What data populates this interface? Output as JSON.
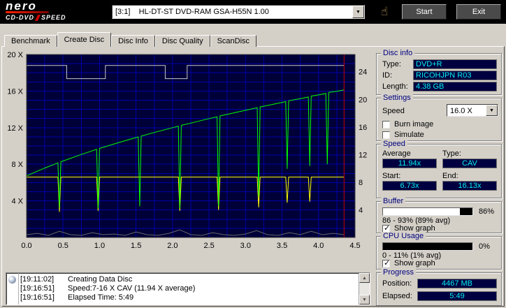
{
  "icons": {
    "dropdown_arrow": "▼",
    "scroll_up_arrow": "▲",
    "scroll_down_arrow": "▼",
    "hand_pointer": "☝"
  },
  "header": {
    "logo": {
      "name": "nero",
      "sub_left": "CD-DVD",
      "sub_right": "SPEED"
    },
    "drive_combo": {
      "value": "[3:1]    HL-DT-ST DVD-RAM GSA-H55N 1.00"
    },
    "start_button": "Start",
    "exit_button": "Exit"
  },
  "tabs": {
    "items": [
      {
        "label": "Benchmark",
        "active": false
      },
      {
        "label": "Create Disc",
        "active": true
      },
      {
        "label": "Disc Info",
        "active": false
      },
      {
        "label": "Disc Quality",
        "active": false
      },
      {
        "label": "ScanDisc",
        "active": false
      }
    ]
  },
  "chart_data": {
    "type": "line",
    "title": "",
    "xlabel": "",
    "x_axis": {
      "lim": [
        0,
        4.5
      ],
      "ticks": [
        {
          "v": 0,
          "label": "0.0"
        },
        {
          "v": 0.5,
          "label": "0.5"
        },
        {
          "v": 1.0,
          "label": "1.0"
        },
        {
          "v": 1.5,
          "label": "1.5"
        },
        {
          "v": 2.0,
          "label": "2.0"
        },
        {
          "v": 2.5,
          "label": "2.5"
        },
        {
          "v": 3.0,
          "label": "3.0"
        },
        {
          "v": 3.5,
          "label": "3.5"
        },
        {
          "v": 4.0,
          "label": "4.0"
        },
        {
          "v": 4.5,
          "label": "4.5"
        }
      ]
    },
    "left_axis": {
      "lim": [
        0,
        20
      ],
      "ticks": [
        {
          "v": 20,
          "label": "20 X"
        },
        {
          "v": 16,
          "label": "16 X"
        },
        {
          "v": 12,
          "label": "12 X"
        },
        {
          "v": 8,
          "label": "8 X"
        },
        {
          "v": 4,
          "label": "4 X"
        }
      ]
    },
    "right_axis": {
      "lim": [
        0,
        26.5
      ],
      "ticks": [
        {
          "v": 24,
          "label": "24"
        },
        {
          "v": 20,
          "label": "20"
        },
        {
          "v": 16,
          "label": "16"
        },
        {
          "v": 12,
          "label": "12"
        },
        {
          "v": 8,
          "label": "8"
        },
        {
          "v": 4,
          "label": "4"
        }
      ]
    },
    "grid": {
      "bg": "#000038",
      "color": "#0000a8",
      "x_step": 0.25,
      "y_step": 1
    },
    "position_line": {
      "x": 4.35,
      "color": "#c00000"
    },
    "series": [
      {
        "name": "cpu_usage",
        "color": "#686868",
        "axis": "right",
        "points": [
          [
            0,
            0.4
          ],
          [
            0.15,
            0.6
          ],
          [
            0.3,
            0.3
          ],
          [
            0.45,
            0.9
          ],
          [
            0.6,
            0.4
          ],
          [
            0.75,
            0.3
          ],
          [
            0.9,
            0.7
          ],
          [
            1.05,
            0.4
          ],
          [
            1.2,
            0.5
          ],
          [
            1.35,
            0.3
          ],
          [
            1.5,
            0.8
          ],
          [
            1.65,
            0.4
          ],
          [
            1.8,
            0.3
          ],
          [
            1.95,
            0.6
          ],
          [
            2.1,
            1.1
          ],
          [
            2.25,
            0.4
          ],
          [
            2.4,
            0.3
          ],
          [
            2.55,
            0.7
          ],
          [
            2.7,
            0.4
          ],
          [
            2.85,
            0.3
          ],
          [
            3.0,
            0.5
          ],
          [
            3.15,
            1.0
          ],
          [
            3.3,
            0.4
          ],
          [
            3.45,
            0.3
          ],
          [
            3.6,
            0.7
          ],
          [
            3.75,
            0.4
          ],
          [
            3.9,
            0.9
          ],
          [
            4.05,
            0.4
          ],
          [
            4.2,
            0.6
          ],
          [
            4.35,
            0.4
          ]
        ]
      },
      {
        "name": "buffer_level",
        "color": "#c8c8c8",
        "axis": "right",
        "points": [
          [
            0,
            24.9
          ],
          [
            0.55,
            24.9
          ],
          [
            0.55,
            23.0
          ],
          [
            1.08,
            23.0
          ],
          [
            1.08,
            24.9
          ],
          [
            1.9,
            24.9
          ],
          [
            1.9,
            23.0
          ],
          [
            2.2,
            23.0
          ],
          [
            2.2,
            24.9
          ],
          [
            4.35,
            24.9
          ]
        ]
      },
      {
        "name": "secondary_speed",
        "color": "#ffff00",
        "axis": "left",
        "points": [
          [
            0,
            6.6
          ],
          [
            0.43,
            6.6
          ],
          [
            0.45,
            2.8
          ],
          [
            0.47,
            6.6
          ],
          [
            0.96,
            6.6
          ],
          [
            0.98,
            2.9
          ],
          [
            1.0,
            6.6
          ],
          [
            2.08,
            6.6
          ],
          [
            2.1,
            2.9
          ],
          [
            2.12,
            6.6
          ],
          [
            2.61,
            6.6
          ],
          [
            2.63,
            3.0
          ],
          [
            2.65,
            6.6
          ],
          [
            3.16,
            6.6
          ],
          [
            3.18,
            3.3
          ],
          [
            3.2,
            6.6
          ],
          [
            3.55,
            6.6
          ],
          [
            3.57,
            3.8
          ],
          [
            3.59,
            6.6
          ],
          [
            3.86,
            6.6
          ],
          [
            3.88,
            3.9
          ],
          [
            3.9,
            6.6
          ],
          [
            4.35,
            6.6
          ]
        ]
      },
      {
        "name": "write_speed",
        "color": "#00ff00",
        "axis": "left",
        "points": [
          [
            0,
            6.73
          ],
          [
            0.25,
            7.59
          ],
          [
            0.43,
            8.15
          ],
          [
            0.45,
            3.3
          ],
          [
            0.47,
            8.27
          ],
          [
            0.5,
            8.36
          ],
          [
            0.75,
            9.07
          ],
          [
            0.96,
            9.63
          ],
          [
            0.98,
            3.2
          ],
          [
            1.0,
            9.73
          ],
          [
            1.25,
            10.34
          ],
          [
            1.5,
            10.92
          ],
          [
            1.53,
            10.99
          ],
          [
            1.55,
            3.4
          ],
          [
            1.57,
            11.08
          ],
          [
            1.75,
            11.47
          ],
          [
            2.0,
            12.0
          ],
          [
            2.08,
            12.16
          ],
          [
            2.1,
            3.2
          ],
          [
            2.12,
            12.26
          ],
          [
            2.25,
            12.5
          ],
          [
            2.5,
            12.99
          ],
          [
            2.61,
            13.19
          ],
          [
            2.63,
            3.4
          ],
          [
            2.65,
            13.29
          ],
          [
            2.75,
            13.45
          ],
          [
            3.0,
            13.9
          ],
          [
            3.16,
            14.18
          ],
          [
            3.18,
            4.5
          ],
          [
            3.2,
            14.27
          ],
          [
            3.25,
            14.34
          ],
          [
            3.5,
            14.76
          ],
          [
            3.55,
            14.85
          ],
          [
            3.57,
            7.5
          ],
          [
            3.59,
            14.94
          ],
          [
            3.75,
            15.17
          ],
          [
            3.86,
            15.35
          ],
          [
            3.88,
            7.8
          ],
          [
            3.9,
            15.45
          ],
          [
            4.0,
            15.58
          ],
          [
            4.1,
            15.73
          ],
          [
            4.12,
            8.0
          ],
          [
            4.14,
            15.86
          ],
          [
            4.25,
            15.97
          ],
          [
            4.35,
            16.13
          ]
        ]
      }
    ]
  },
  "panels": {
    "disc_info": {
      "title": "Disc info",
      "rows": [
        {
          "label": "Type:",
          "value": "DVD+R"
        },
        {
          "label": "ID:",
          "value": "RICOHJPN R03"
        },
        {
          "label": "Length:",
          "value": "4.38 GB"
        }
      ]
    },
    "settings": {
      "title": "Settings",
      "speed_label": "Speed",
      "speed_value": "16.0 X",
      "burn_image": {
        "label": "Burn image",
        "checked": false
      },
      "simulate": {
        "label": "Simulate",
        "checked": false
      }
    },
    "speed": {
      "title": "Speed",
      "average_label": "Average",
      "average_value": "11.94x",
      "type_label": "Type:",
      "type_value": "CAV",
      "start_label": "Start:",
      "start_value": "6.73x",
      "end_label": "End:",
      "end_value": "16.13x"
    },
    "buffer": {
      "title": "Buffer",
      "percent_fill": 86,
      "percent_label": "86%",
      "range_text": "86 - 93% (89% avg)",
      "show_graph": {
        "label": "Show graph",
        "checked": true
      }
    },
    "cpu": {
      "title": "CPU Usage",
      "percent_fill": 0,
      "percent_label": "0%",
      "range_text": "0 - 11% (1% avg)",
      "show_graph": {
        "label": "Show graph",
        "checked": true
      }
    },
    "progress": {
      "title": "Progress",
      "position_label": "Position:",
      "position_value": "4467 MB",
      "elapsed_label": "Elapsed:",
      "elapsed_value": "5:49"
    }
  },
  "log": {
    "entries": [
      {
        "time": "[19:11:02]",
        "text": "Creating Data Disc"
      },
      {
        "time": "[19:16:51]",
        "text": "Speed:7-16 X CAV (11.94 X average)"
      },
      {
        "time": "[19:16:51]",
        "text": "Elapsed Time: 5:49"
      }
    ]
  }
}
